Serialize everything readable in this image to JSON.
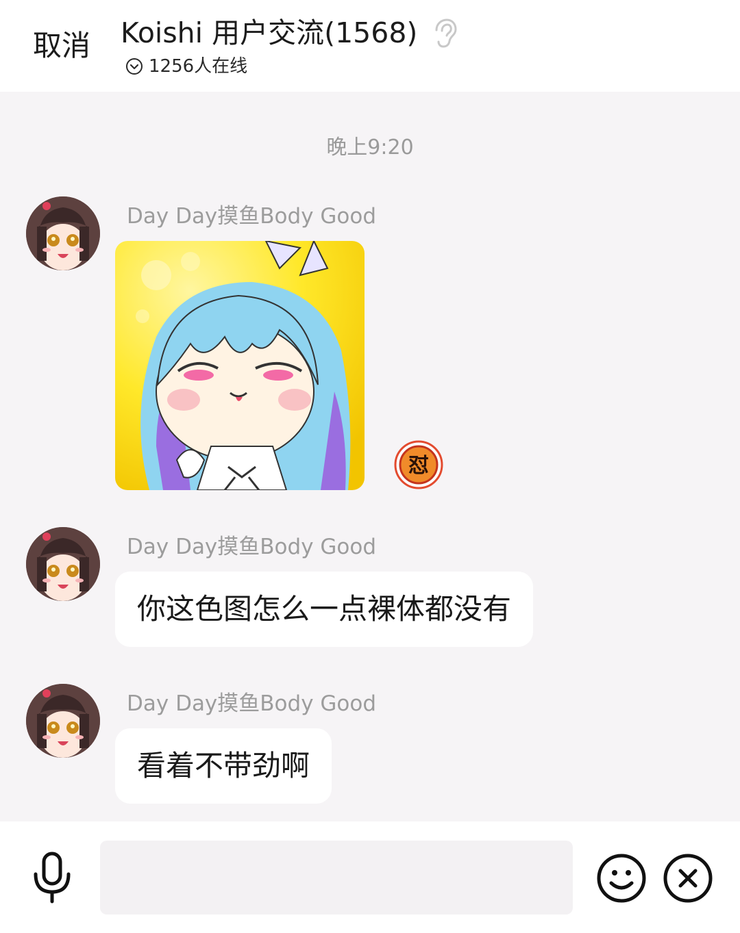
{
  "header": {
    "cancel_label": "取消",
    "title": "Koishi 用户交流(1568)",
    "ear_icon": "ear-icon",
    "online_icon": "chevron-circle-icon",
    "online_text": "1256人在线"
  },
  "timestamp": "晚上9:20",
  "messages": [
    {
      "sender": "Day Day摸鱼Body Good",
      "type": "sticker",
      "sticker_desc": "anime-girl-sticker",
      "badge_icon": "怼"
    },
    {
      "sender": "Day Day摸鱼Body Good",
      "type": "text",
      "text": "你这色图怎么一点裸体都没有"
    },
    {
      "sender": "Day Day摸鱼Body Good",
      "type": "text",
      "text": "看着不带劲啊"
    }
  ],
  "input_bar": {
    "voice_icon": "microphone-icon",
    "input_value": "",
    "input_placeholder": "",
    "emoji_icon": "smiley-icon",
    "close_icon": "close-circle-icon"
  },
  "colors": {
    "background": "#f6f4f6",
    "bubble": "#ffffff",
    "sender_text": "#9c9c9c"
  }
}
